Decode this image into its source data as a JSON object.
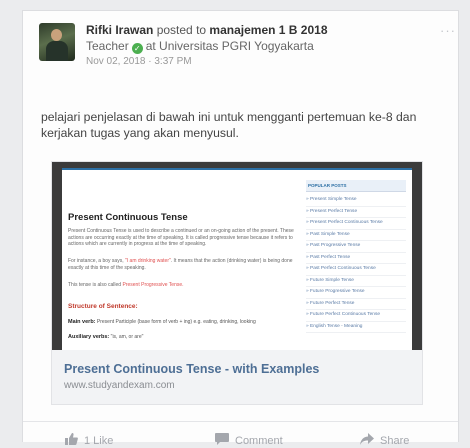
{
  "post": {
    "author": "Rifki Irawan",
    "posted_to": "posted to",
    "group": "manajemen 1 B 2018",
    "role": "Teacher",
    "verified_mark": "✓",
    "at_text": "at Universitas PGRI Yogyakarta",
    "date": "Nov 02, 2018 · 3:37 PM",
    "more": "···",
    "text": "pelajari penjelasan di bawah ini untuk mengganti pertemuan ke-8 dan kerjakan tugas yang akan menyusul."
  },
  "link": {
    "title": "Present Continuous Tense - with Examples",
    "url": "www.studyandexam.com",
    "preview": {
      "heading": "Present Continuous Tense",
      "para1": "Present Continuous Tense is used to describe a continued or an on-going action of the present. These actions are occurring exactly at the time of speaking. It is called progressive tense because it refers to actions which are currently in progress at the time of speaking.",
      "para2_a": "For instance, a boy says, ",
      "para2_quote": "\"I am drinking water\"",
      "para2_b": ". It means that the action (drinking water) is being done exactly at this time of the speaking.",
      "para3_a": "This tense is also called ",
      "para3_red": "Present Progressive Tense.",
      "structure": "Structure of Sentence:",
      "main_verb_label": "Main verb:",
      "main_verb_text": " Present Participle (base form of verb + ing) e.g. eating, drinking, looking",
      "aux_label": "Auxiliary verbs:",
      "aux_text": " \"is, am, or are\"",
      "sidebar_heading": "POPULAR POSTS",
      "sidebar_items": [
        "Present Simple Tense",
        "Present Perfect Tense",
        "Present Perfect Continuous Tense",
        "Past Simple Tense",
        "Past Progressive Tense",
        "Past Perfect Tense",
        "Past Perfect Continuous Tense",
        "Future Simple Tense",
        "Future Progressive Tense",
        "Future Perfect Tense",
        "Future Perfect Continuous Tense",
        "English Tense - Meaning"
      ]
    }
  },
  "actions": {
    "like": "1 Like",
    "comment": "Comment",
    "share": "Share"
  },
  "colors": {
    "link_title": "#4e6f95",
    "verified": "#4caf50",
    "action_gray": "#a4a7ad"
  }
}
